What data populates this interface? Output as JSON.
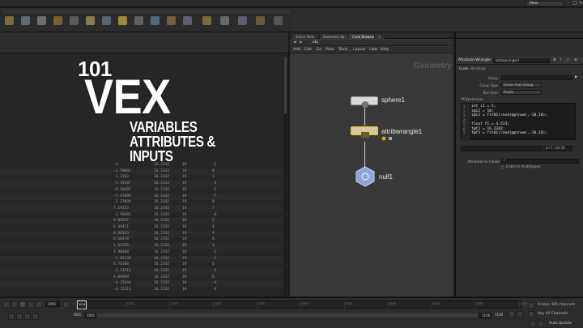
{
  "window": {
    "desktop": "Main"
  },
  "overlay": {
    "line1": "101",
    "line2": "VEX",
    "line3": "VARIABLES",
    "line4": "ATTRIBUTES &",
    "line5": "INPUTS"
  },
  "network": {
    "tabs": [
      "Scene View",
      "Geometry Sp...",
      "Code Browser",
      "+"
    ],
    "menu": [
      "Add",
      "Edit",
      "Go",
      "View",
      "Tools",
      "Layout",
      "Labs",
      "Help"
    ],
    "context_label": "Geometry",
    "path": "obj",
    "nodes": [
      {
        "name": "sphere1",
        "color": "#d8d8d8"
      },
      {
        "name": "attribwrangle1",
        "color": "#d8c79a"
      },
      {
        "name": "null1",
        "color": "#8fa3d8"
      }
    ]
  },
  "params": {
    "node_type": "Attribute Wrangle",
    "node_name": "attribwrangle1",
    "tabs": [
      "Code",
      "Bindings"
    ],
    "group_label": "Group",
    "group_value": "",
    "group_type_label": "Group Type",
    "group_type_value": "Guess from Group",
    "run_over_label": "Run Over",
    "run_over_value": "Points",
    "vexpression_label": "VEXpression",
    "code_lines": [
      "int i1 = 5;",
      "i@i2 = 10;",
      "i@i3 = fit01(rand(@ptnum),-10,10);",
      "",
      "float f1 = 4.523;",
      "f@f2 = 16.2342;",
      "f@f3 = fit01(rand(@ptnum),-10,10);"
    ],
    "cursor_pos": "Ln 7, Col 35",
    "attributes_label": "Attributes to Create",
    "attributes_value": "*",
    "enforce_label": "Enforce Prototypes"
  },
  "spreadsheet": {
    "rows": [
      [
        "-3",
        "16.2342",
        "19",
        "-2"
      ],
      [
        "-2.50002",
        "16.2342",
        "19",
        "0"
      ],
      [
        "-1.3103",
        "16.2342",
        "19",
        "3"
      ],
      [
        "-5.19387",
        "16.2342",
        "19",
        "-4"
      ],
      [
        "-8.50487",
        "16.2342",
        "19",
        "-5"
      ],
      [
        "-7.47896",
        "16.2342",
        "19",
        "-7"
      ],
      [
        "-2.27094",
        "16.2342",
        "19",
        "8"
      ],
      [
        "7.19153",
        "16.2342",
        "19",
        "7"
      ],
      [
        "-3.99403",
        "16.2342",
        "19",
        "-8"
      ],
      [
        "0.89537",
        "16.2342",
        "19",
        "5"
      ],
      [
        "6.44411",
        "16.2342",
        "19",
        "4"
      ],
      [
        "0.90343",
        "16.2342",
        "19",
        "4"
      ],
      [
        "0.68478",
        "16.2342",
        "19",
        "0"
      ],
      [
        "1.64226",
        "16.2342",
        "19",
        "1"
      ],
      [
        "9.90498",
        "16.2342",
        "19",
        "-1"
      ],
      [
        "-5.05238",
        "16.2342",
        "19",
        "-5"
      ],
      [
        "6.76388",
        "16.2342",
        "19",
        "6"
      ],
      [
        "-3.24511",
        "16.2342",
        "19",
        "-3"
      ],
      [
        "6.09609",
        "16.2342",
        "19",
        "6"
      ],
      [
        "-4.37644",
        "16.2342",
        "19",
        "-4"
      ],
      [
        "-3.22213",
        "16.2342",
        "19",
        "-3"
      ]
    ]
  },
  "timeline": {
    "current_frame": "1001",
    "start_frame": "1001",
    "start_frame2": "1001",
    "end_frame": "1100",
    "end_frame2": "1100",
    "ticks": [
      "1001",
      "1050",
      "1100",
      "1150",
      "1200",
      "1250",
      "1300",
      "1350",
      "1400",
      "1450",
      "1500"
    ],
    "keys_label": "0 keys, 0/0 channels",
    "key_all_label": "Key All Channels",
    "auto_update": "Auto Update"
  }
}
